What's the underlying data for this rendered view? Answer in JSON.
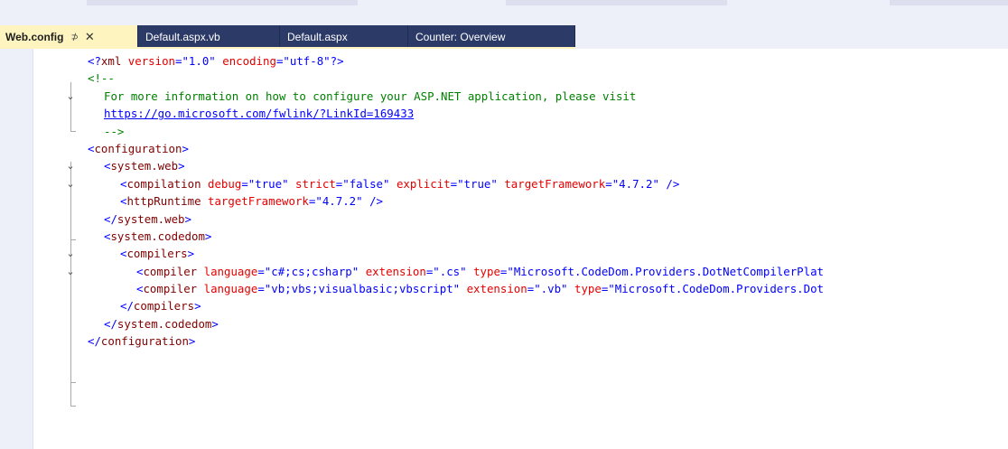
{
  "tabs": [
    {
      "label": "Web.config",
      "active": true,
      "pin_icon": "pin-icon",
      "close_icon": "close-icon"
    },
    {
      "label": "Default.aspx.vb",
      "active": false
    },
    {
      "label": "Default.aspx",
      "active": false
    },
    {
      "label": "Counter: Overview",
      "active": false
    }
  ],
  "pin_glyph": "⊅",
  "close_glyph": "✕",
  "fold_glyph": "⌄",
  "code": {
    "xml_decl": {
      "open": "<?",
      "name": "xml",
      "a1": "version",
      "eq": "=",
      "v1": "\"1.0\"",
      "a2": "encoding",
      "v2": "\"utf-8\"",
      "close": "?>"
    },
    "comment_open": "<!--",
    "comment_line1": "For more information on how to configure your ASP.NET application, please visit",
    "comment_link": "https://go.microsoft.com/fwlink/?LinkId=169433",
    "comment_close": "-->",
    "configuration_open": "configuration",
    "system_web": "system.web",
    "compilation": {
      "tag": "compilation",
      "a_debug": "debug",
      "v_debug": "\"true\"",
      "a_strict": "strict",
      "v_strict": "\"false\"",
      "a_explicit": "explicit",
      "v_explicit": "\"true\"",
      "a_tf": "targetFramework",
      "v_tf": "\"4.7.2\""
    },
    "http_runtime": {
      "tag": "httpRuntime",
      "a_tf": "targetFramework",
      "v_tf": "\"4.7.2\""
    },
    "system_web_close": "system.web",
    "system_codedom": "system.codedom",
    "compilers": "compilers",
    "compiler1": {
      "tag": "compiler",
      "a_lang": "language",
      "v_lang": "\"c#;cs;csharp\"",
      "a_ext": "extension",
      "v_ext": "\".cs\"",
      "a_type": "type",
      "v_type": "\"Microsoft.CodeDom.Providers.DotNetCompilerPlat"
    },
    "compiler2": {
      "tag": "compiler",
      "a_lang": "language",
      "v_lang": "\"vb;vbs;visualbasic;vbscript\"",
      "a_ext": "extension",
      "v_ext": "\".vb\"",
      "a_type": "type",
      "v_type": "\"Microsoft.CodeDom.Providers.Dot"
    },
    "compilers_close": "compilers",
    "system_codedom_close": "system.codedom",
    "configuration_close": "configuration"
  }
}
